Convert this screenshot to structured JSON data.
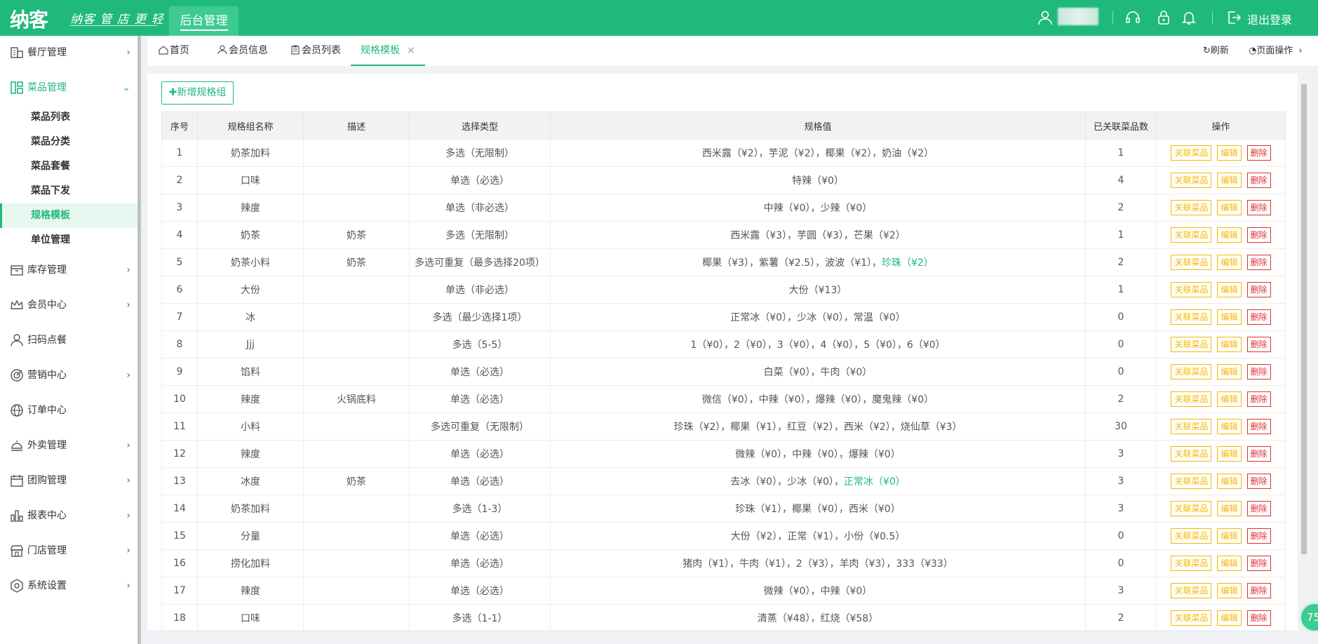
{
  "topbar": {
    "logo": "纳客",
    "slogan": "纳客 管 店 更 轻 松",
    "admin_tab": "后台管理",
    "logout": "退出登录",
    "icons": [
      "user-icon",
      "headset-icon",
      "lock-icon",
      "bell-icon",
      "logout-icon"
    ]
  },
  "sidebar": {
    "items": [
      {
        "label": "餐厅管理",
        "icon": "restaurant-icon",
        "chev": "›"
      },
      {
        "label": "菜品管理",
        "icon": "dishes-icon",
        "chev": "⌄"
      },
      {
        "label": "库存管理",
        "icon": "inventory-icon",
        "chev": "›"
      },
      {
        "label": "会员中心",
        "icon": "crown-icon",
        "chev": "›"
      },
      {
        "label": "扫码点餐",
        "icon": "person-icon",
        "chev": ""
      },
      {
        "label": "营销中心",
        "icon": "target-icon",
        "chev": "›"
      },
      {
        "label": "订单中心",
        "icon": "globe-icon",
        "chev": ""
      },
      {
        "label": "外卖管理",
        "icon": "cloche-icon",
        "chev": "›"
      },
      {
        "label": "团购管理",
        "icon": "calendar-icon",
        "chev": "›"
      },
      {
        "label": "报表中心",
        "icon": "chart-icon",
        "chev": "›"
      },
      {
        "label": "门店管理",
        "icon": "store-icon",
        "chev": "›"
      },
      {
        "label": "系统设置",
        "icon": "settings-icon",
        "chev": "›"
      }
    ],
    "sub_items": [
      "菜品列表",
      "菜品分类",
      "菜品套餐",
      "菜品下发",
      "规格模板",
      "单位管理"
    ]
  },
  "tabs": {
    "items": [
      "首页",
      "会员信息",
      "会员列表",
      "规格模板"
    ],
    "close": "×",
    "refresh": "刷新",
    "page_ops": "页面操作"
  },
  "main": {
    "add_button": "✚新增规格组",
    "columns": [
      "序号",
      "规格组名称",
      "描述",
      "选择类型",
      "规格值",
      "已关联菜品数",
      "操作"
    ],
    "actions": {
      "link": "关联菜品",
      "edit": "编辑",
      "delete": "删除"
    },
    "rows": [
      {
        "no": "1",
        "name": "奶茶加料",
        "desc": "",
        "type": "多选（无限制）",
        "values": "西米露（¥2），芋泥（¥2），椰果（¥2），奶油（¥2）",
        "values_hl": "",
        "count": "1"
      },
      {
        "no": "2",
        "name": "口味",
        "desc": "",
        "type": "单选（必选）",
        "values": "特辣（¥0）",
        "values_hl": "",
        "count": "4"
      },
      {
        "no": "3",
        "name": "辣度",
        "desc": "",
        "type": "单选（非必选）",
        "values": "中辣（¥0），少辣（¥0）",
        "values_hl": "",
        "count": "2"
      },
      {
        "no": "4",
        "name": "奶茶",
        "desc": "奶茶",
        "type": "多选（无限制）",
        "values": "西米露（¥3），芋圆（¥3），芒果（¥2）",
        "values_hl": "",
        "count": "1"
      },
      {
        "no": "5",
        "name": "奶茶小料",
        "desc": "奶茶",
        "type": "多选可重复（最多选择20项）",
        "values": "椰果（¥3），紫薯（¥2.5），波波（¥1），",
        "values_hl": "珍珠（¥2）",
        "count": "2"
      },
      {
        "no": "6",
        "name": "大份",
        "desc": "",
        "type": "单选（非必选）",
        "values": "大份（¥13）",
        "values_hl": "",
        "count": "1"
      },
      {
        "no": "7",
        "name": "冰",
        "desc": "",
        "type": "多选（最少选择1项）",
        "values": "正常冰（¥0），少冰（¥0），常温（¥0）",
        "values_hl": "",
        "count": "0"
      },
      {
        "no": "8",
        "name": "Jjj",
        "desc": "",
        "type": "多选（5-5）",
        "values": "1（¥0），2（¥0），3（¥0），4（¥0），5（¥0），6（¥0）",
        "values_hl": "",
        "count": "0"
      },
      {
        "no": "9",
        "name": "馅料",
        "desc": "",
        "type": "单选（必选）",
        "values": "白菜（¥0），牛肉（¥0）",
        "values_hl": "",
        "count": "0"
      },
      {
        "no": "10",
        "name": "辣度",
        "desc": "火锅底料",
        "type": "单选（必选）",
        "values": "微信（¥0），中辣（¥0），爆辣（¥0），魔鬼辣（¥0）",
        "values_hl": "",
        "count": "2"
      },
      {
        "no": "11",
        "name": "小料",
        "desc": "",
        "type": "多选可重复（无限制）",
        "values": "珍珠（¥2），椰果（¥1），红豆（¥2），西米（¥2），烧仙草（¥3）",
        "values_hl": "",
        "count": "30"
      },
      {
        "no": "12",
        "name": "辣度",
        "desc": "",
        "type": "单选（必选）",
        "values": "微辣（¥0），中辣（¥0），爆辣（¥0）",
        "values_hl": "",
        "count": "3"
      },
      {
        "no": "13",
        "name": "冰度",
        "desc": "奶茶",
        "type": "单选（必选）",
        "values": "去冰（¥0），少冰（¥0），",
        "values_hl": "正常冰（¥0）",
        "count": "3"
      },
      {
        "no": "14",
        "name": "奶茶加料",
        "desc": "",
        "type": "多选（1-3）",
        "values": "珍珠（¥1），椰果（¥0），西米（¥0）",
        "values_hl": "",
        "count": "3"
      },
      {
        "no": "15",
        "name": "分量",
        "desc": "",
        "type": "单选（必选）",
        "values": "大份（¥2），正常（¥1），小份（¥0.5）",
        "values_hl": "",
        "count": "0"
      },
      {
        "no": "16",
        "name": "捞化加料",
        "desc": "",
        "type": "单选（必选）",
        "values": "猪肉（¥1），牛肉（¥1），2（¥3），羊肉（¥3），333（¥33）",
        "values_hl": "",
        "count": "0"
      },
      {
        "no": "17",
        "name": "辣度",
        "desc": "",
        "type": "单选（必选）",
        "values": "微辣（¥0），中辣（¥0）",
        "values_hl": "",
        "count": "3"
      },
      {
        "no": "18",
        "name": "口味",
        "desc": "",
        "type": "多选（1-1）",
        "values": "清蒸（¥48），红烧（¥58）",
        "values_hl": "",
        "count": "2"
      }
    ]
  },
  "badge": "75",
  "colors": {
    "brand": "#1fb97c",
    "warn": "#f5b800",
    "danger": "#e0302f"
  }
}
